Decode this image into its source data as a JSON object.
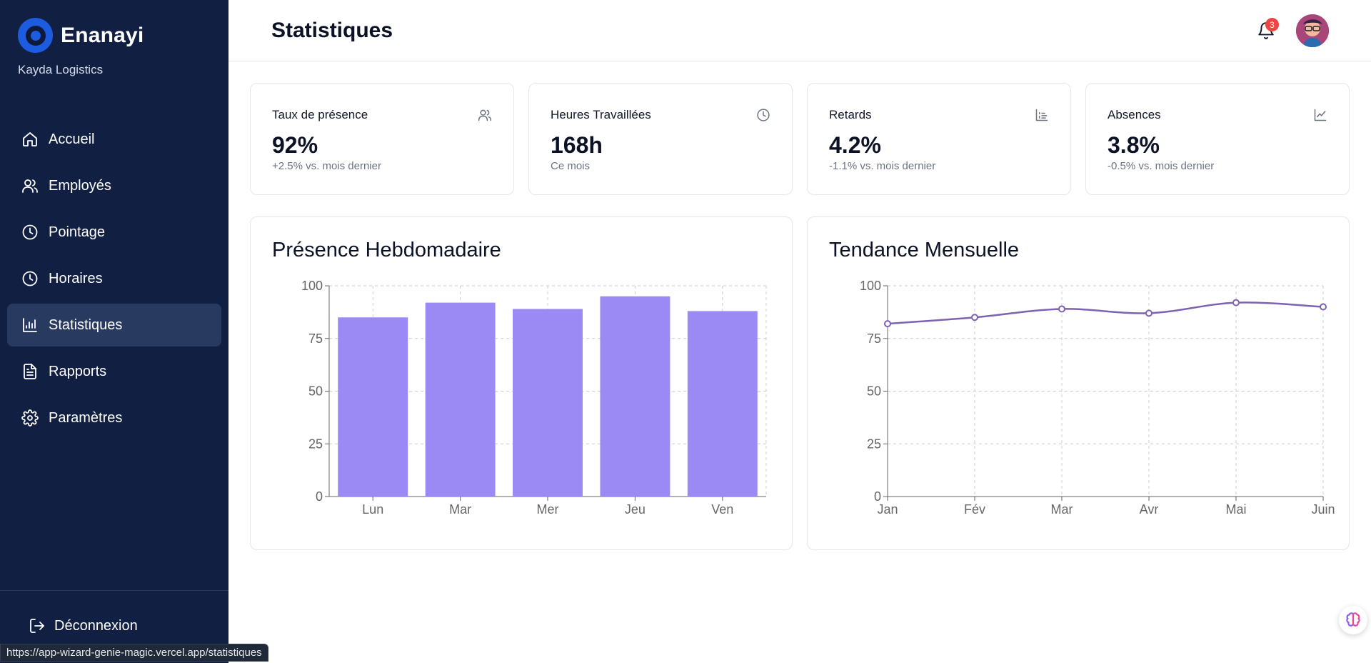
{
  "brand": {
    "name": "Enanayi",
    "company": "Kayda Logistics"
  },
  "nav": {
    "items": [
      {
        "label": "Accueil",
        "icon": "home-icon",
        "active": false
      },
      {
        "label": "Employés",
        "icon": "users-icon",
        "active": false
      },
      {
        "label": "Pointage",
        "icon": "clock-icon",
        "active": false
      },
      {
        "label": "Horaires",
        "icon": "clock-icon",
        "active": false
      },
      {
        "label": "Statistiques",
        "icon": "bar-chart-icon",
        "active": true
      },
      {
        "label": "Rapports",
        "icon": "file-text-icon",
        "active": false
      },
      {
        "label": "Paramètres",
        "icon": "gear-icon",
        "active": false
      }
    ],
    "logout_label": "Déconnexion"
  },
  "header": {
    "title": "Statistiques",
    "notification_count": "3"
  },
  "stats": [
    {
      "label": "Taux de présence",
      "value": "92%",
      "sub": "+2.5% vs. mois dernier",
      "icon": "users-icon"
    },
    {
      "label": "Heures Travaillées",
      "value": "168h",
      "sub": "Ce mois",
      "icon": "clock-icon"
    },
    {
      "label": "Retards",
      "value": "4.2%",
      "sub": "-1.1% vs. mois dernier",
      "icon": "bar-chart-icon"
    },
    {
      "label": "Absences",
      "value": "3.8%",
      "sub": "-0.5% vs. mois dernier",
      "icon": "line-chart-icon"
    }
  ],
  "chart_data": [
    {
      "type": "bar",
      "title": "Présence Hebdomadaire",
      "categories": [
        "Lun",
        "Mar",
        "Mer",
        "Jeu",
        "Ven"
      ],
      "values": [
        85,
        92,
        89,
        95,
        88
      ],
      "ylim": [
        0,
        100
      ],
      "yticks": [
        0,
        25,
        50,
        75,
        100
      ],
      "grid": true,
      "color": "#9b89f4"
    },
    {
      "type": "line",
      "title": "Tendance Mensuelle",
      "categories": [
        "Jan",
        "Fév",
        "Mar",
        "Avr",
        "Mai",
        "Juin"
      ],
      "values": [
        82,
        85,
        89,
        87,
        92,
        90
      ],
      "ylim": [
        0,
        100
      ],
      "yticks": [
        0,
        25,
        50,
        75,
        100
      ],
      "grid": true,
      "color": "#7c62b0"
    }
  ],
  "status_bar": {
    "url": "https://app-wizard-genie-magic.vercel.app/statistiques"
  }
}
